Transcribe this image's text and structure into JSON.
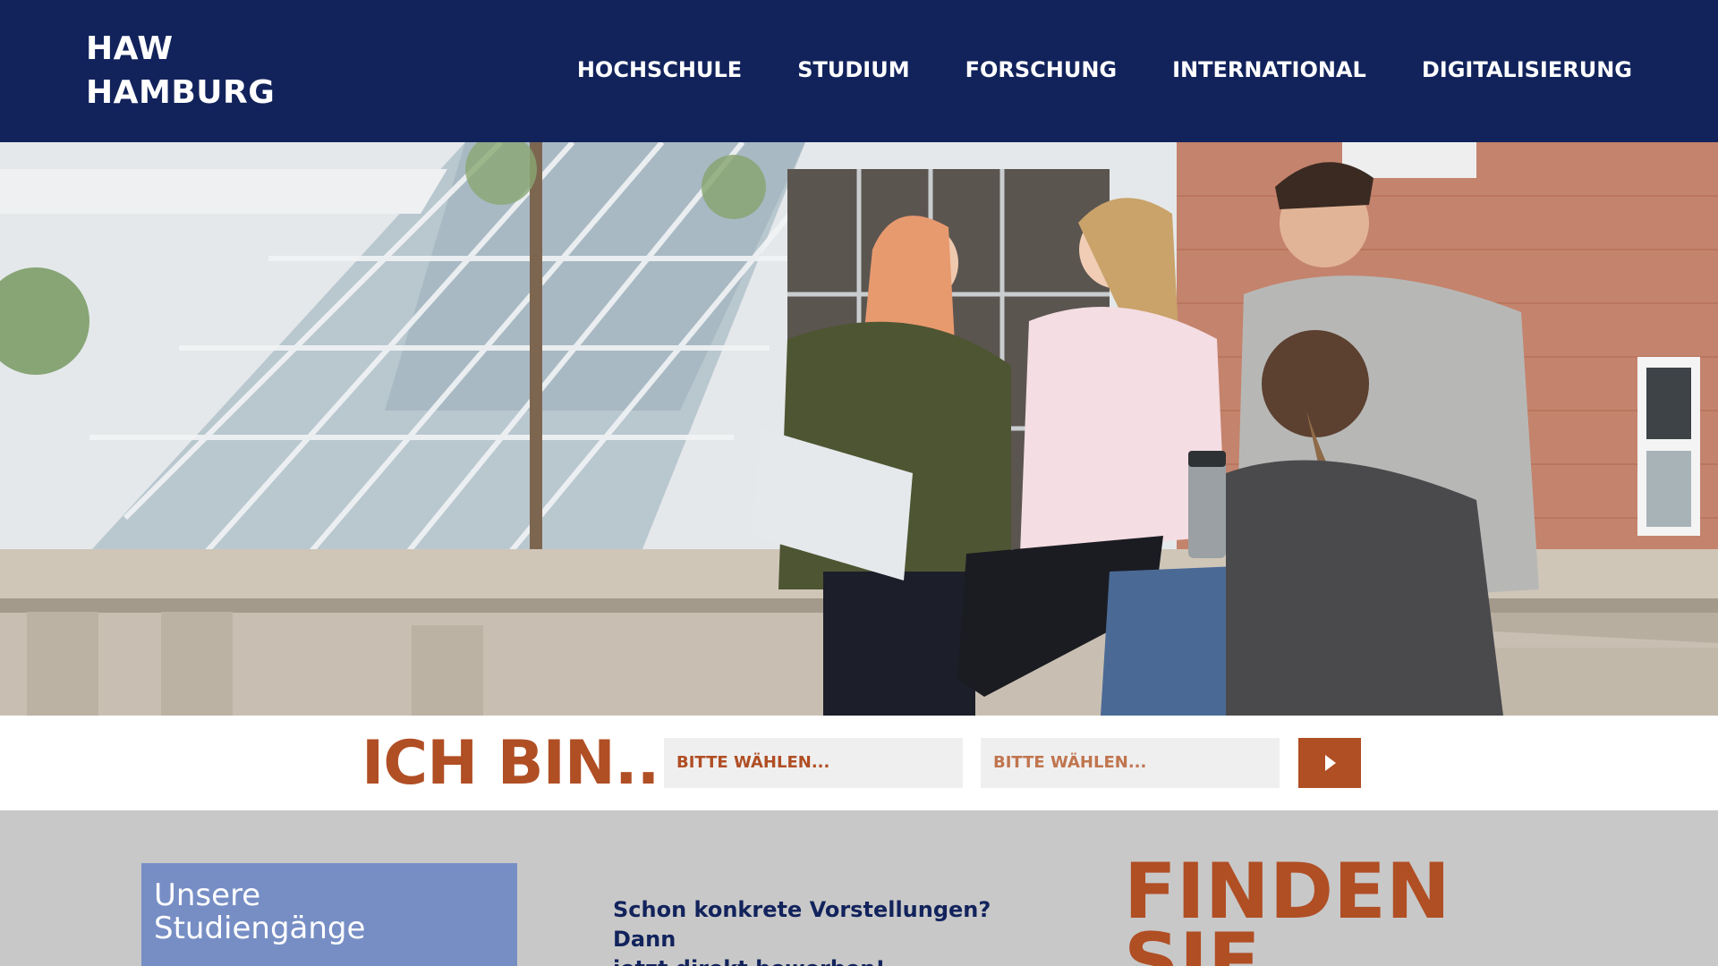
{
  "header": {
    "logo_line1": "HAW",
    "logo_line2": "HAMBURG",
    "nav": [
      {
        "label": "HOCHSCHULE"
      },
      {
        "label": "STUDIUM"
      },
      {
        "label": "FORSCHUNG"
      },
      {
        "label": "INTERNATIONAL"
      },
      {
        "label": "DIGITALISIERUNG"
      }
    ]
  },
  "selector": {
    "heading": "ICH BIN...",
    "select1_value": "BITTE WÄHLEN...",
    "select2_value": "BITTE WÄHLEN...",
    "go_icon": "play-triangle-icon"
  },
  "lower": {
    "card_line1": "Unsere",
    "card_line2": "Studiengänge",
    "apply_line1": "Schon konkrete Vorstellungen? Dann",
    "apply_line2": "jetzt direkt bewerben!",
    "finden_line1": "FINDEN",
    "finden_line2": "SIE"
  },
  "colors": {
    "header_bg": "#12235c",
    "accent": "#b04e24",
    "card_blue": "#778ec5",
    "section_grey": "#c8c8c8"
  }
}
